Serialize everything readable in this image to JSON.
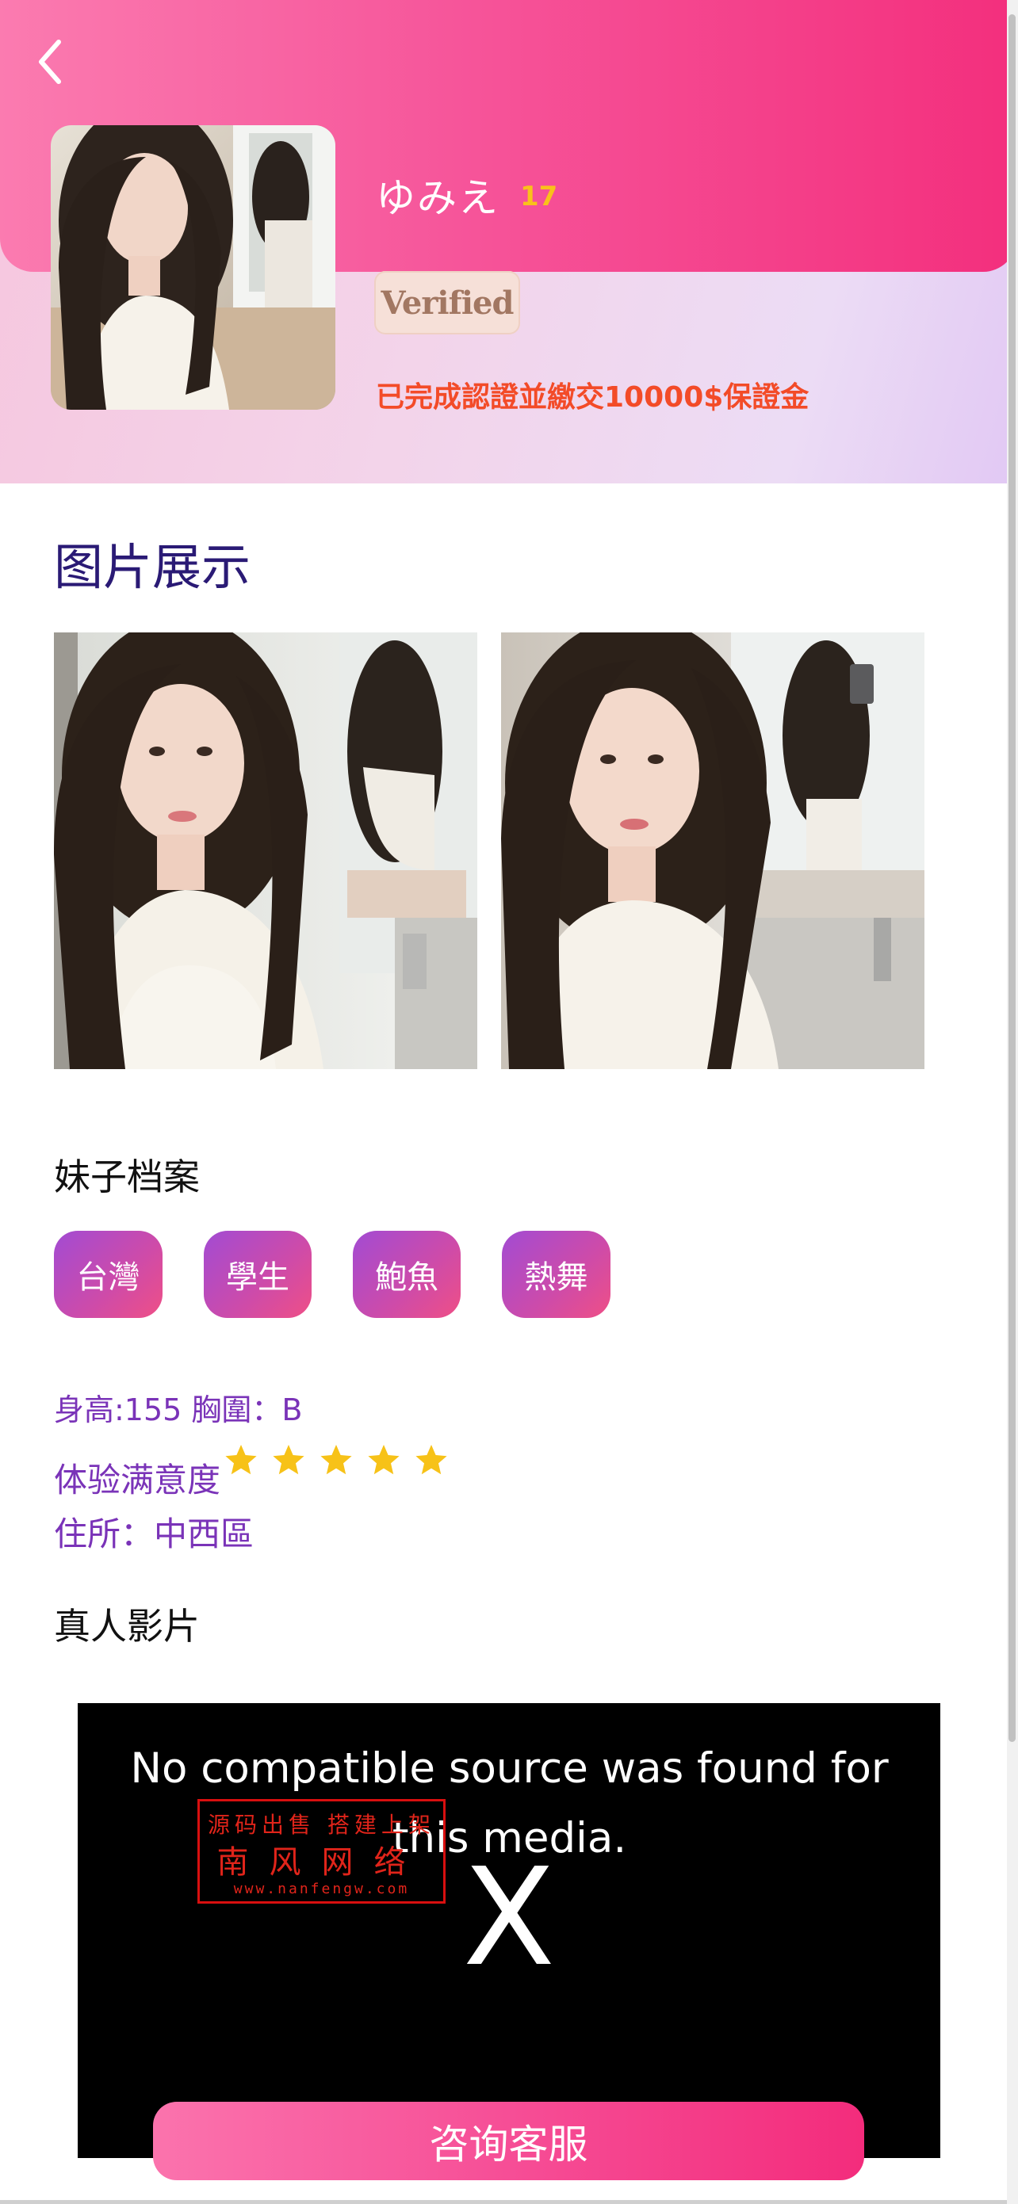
{
  "header": {
    "name": "ゆみえ",
    "age": "17",
    "verified_badge": "Verified",
    "certification": "已完成認證並繳交10000$保證金"
  },
  "gallery": {
    "title": "图片展示",
    "photos": [
      "photo-1",
      "photo-2"
    ]
  },
  "profile": {
    "title": "妹子档案",
    "tags": [
      "台灣",
      "學生",
      "鮑魚",
      "熱舞"
    ],
    "stats_line": "身高:155 胸圍：B",
    "satisfaction_label": "体验满意度",
    "satisfaction_rating": 5,
    "residence": "住所：中西區"
  },
  "video": {
    "title": "真人影片",
    "error_line1": "No compatible source was found for",
    "error_line2": "this media.",
    "close_symbol": "X"
  },
  "watermark": {
    "line1": "源码出售 搭建上架",
    "line2": "南风网络",
    "line3": "www.nanfengw.com"
  },
  "cta": {
    "label": "咨询客服"
  },
  "colors": {
    "accent_pink": "#f32f7d",
    "title_indigo": "#2a1a75",
    "info_purple": "#7a33b8",
    "cert_orange": "#f34b28",
    "age_gold": "#f9c11a",
    "star_gold": "#f7c218"
  },
  "icons": {
    "back": "chevron-left-icon",
    "star": "star-icon"
  }
}
